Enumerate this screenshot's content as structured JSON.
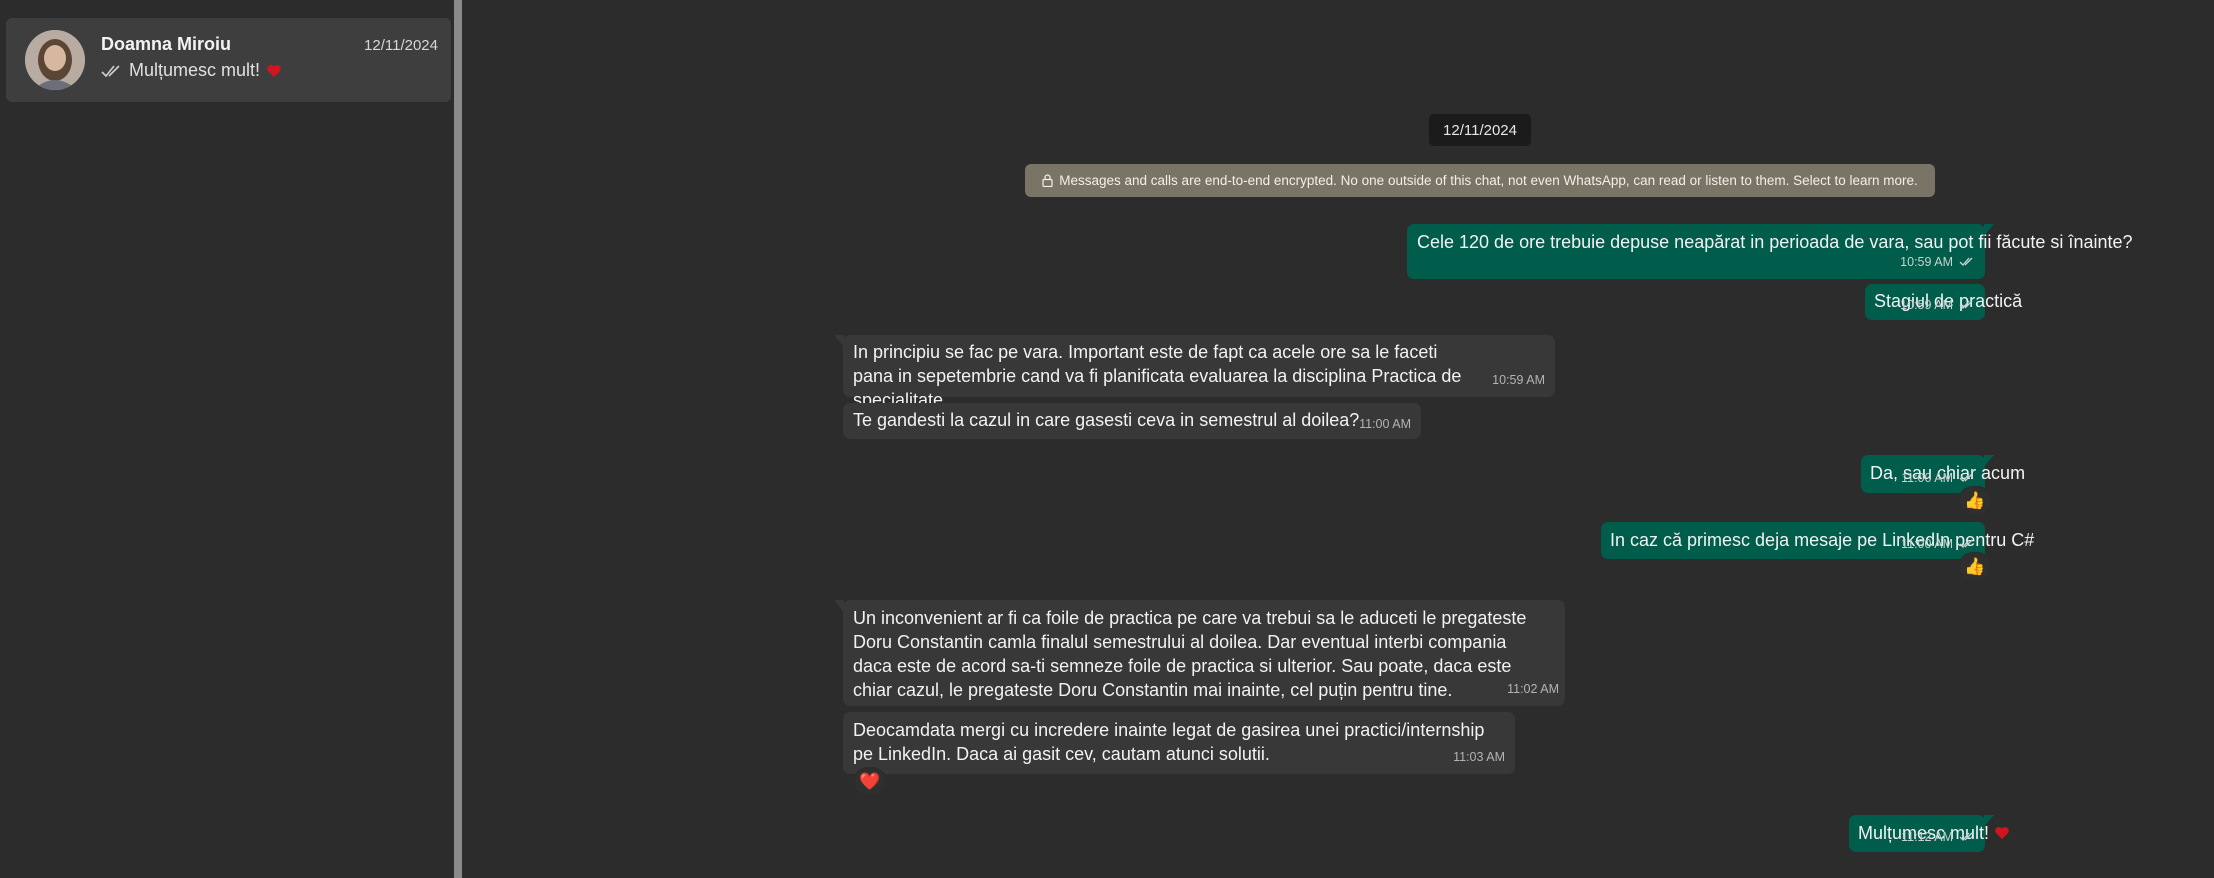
{
  "sidebar": {
    "chat": {
      "name": "Doamna Miroiu",
      "date": "12/11/2024",
      "preview": "Mulțumesc mult!",
      "preview_icon": "double-check-icon",
      "preview_emoji": "red-heart"
    }
  },
  "conversation": {
    "date_chip": "12/11/2024",
    "encryption_notice": "Messages and calls are end-to-end encrypted. No one outside of this chat, not even WhatsApp, can read or listen to them. Select to learn more.",
    "messages": [
      {
        "direction": "out",
        "text": "Cele 120 de ore trebuie depuse neapărat in perioada de vara, sau pot fii făcute si înainte?",
        "time": "10:59 AM"
      },
      {
        "direction": "out",
        "text": "Stagiul de practică",
        "time": "10:59 AM"
      },
      {
        "direction": "in",
        "text": "In principiu se fac pe vara. Important este de fapt ca acele ore sa le faceti pana in sepetembrie cand va fi planificata evaluarea la disciplina Practica de specialitate.",
        "time": "10:59 AM"
      },
      {
        "direction": "in",
        "text": "Te gandesti la cazul in care gasesti ceva in semestrul al doilea?",
        "time": "11:00 AM"
      },
      {
        "direction": "out",
        "text": "Da, sau chiar acum",
        "time": "11:00 AM",
        "reaction": "👍"
      },
      {
        "direction": "out",
        "text": "In caz că primesc deja mesaje pe LinkedIn pentru C#",
        "time": "11:00 AM",
        "reaction": "👍"
      },
      {
        "direction": "in",
        "text": "Un inconvenient ar fi ca foile de practica pe care va trebui sa le aduceti le pregateste Doru Constantin camla finalul semestrului al doilea. Dar eventual interbi compania daca este de acord sa-ti semneze foile de practica si ulterior. Sau poate, daca este chiar cazul, le pregateste Doru Constantin mai inainte, cel puțin pentru tine.",
        "time": "11:02 AM"
      },
      {
        "direction": "in",
        "text": "Deocamdata mergi cu incredere inainte legat de gasirea unei practici/internship pe LinkedIn. Daca ai gasit cev, cautam atunci solutii.",
        "time": "11:03 AM",
        "reaction": "❤️"
      },
      {
        "direction": "out",
        "text": "Mulțumesc mult!",
        "time": "11:12 AM",
        "emoji": "red-heart"
      }
    ]
  },
  "colors": {
    "outgoing_bubble": "#005c4b",
    "incoming_bubble": "#383838",
    "background": "#2c2c2c",
    "encryption_banner": "#7a7466"
  }
}
